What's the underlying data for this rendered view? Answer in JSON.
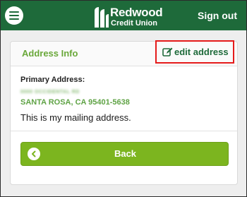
{
  "header": {
    "menu_icon": "hamburger-menu-icon",
    "logo": {
      "line1": "Redwood",
      "line2": "Credit Union"
    },
    "signout_label": "Sign out"
  },
  "card": {
    "title": "Address Info",
    "edit_label": "edit address",
    "edit_icon": "edit-pencil-icon",
    "primary_label": "Primary Address:",
    "street": "0000 OCCIDENTAL RD",
    "city_line": "SANTA ROSA, CA 95401-5638",
    "note": "This is my mailing address.",
    "back_label": "Back",
    "back_icon": "chevron-left-icon"
  },
  "colors": {
    "header_bg": "#1e6a3a",
    "accent_green": "#6aa83a",
    "button_green": "#7cb51f",
    "highlight_red": "#e51b1b"
  }
}
